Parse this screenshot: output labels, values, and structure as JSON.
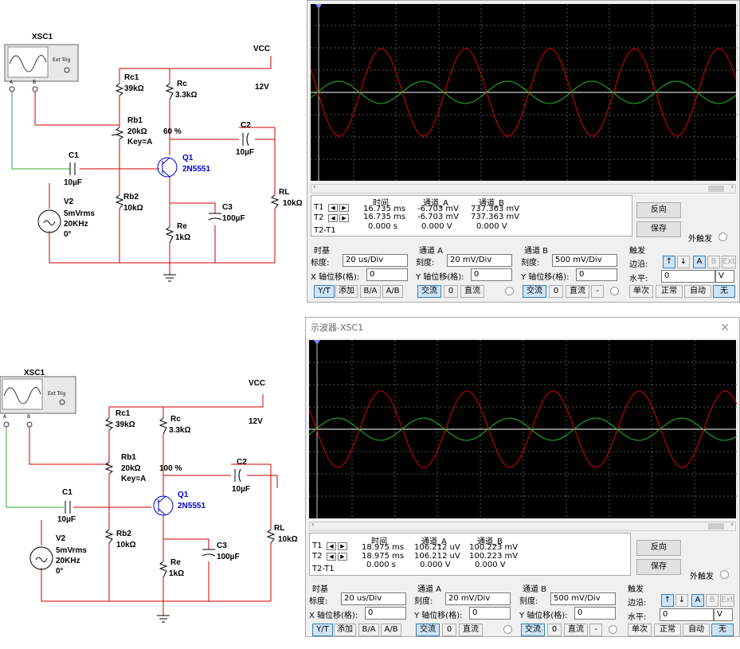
{
  "panels": [
    {
      "circuit": {
        "scope_name": "XSC1",
        "scope_a": "A",
        "scope_b": "B",
        "ext_trig": "Ext Trig",
        "vcc": "VCC",
        "vcc_value": "12V",
        "rc1": "Rc1",
        "rc1_value": "39kΩ",
        "rc": "Rc",
        "rc_value": "3.3kΩ",
        "rb1": "Rb1",
        "rb1_value": "20kΩ",
        "rb1_key": "Key=A",
        "rb1_percent": "60 %",
        "c2": "C2",
        "c2_value": "10µF",
        "q1": "Q1",
        "q1_model": "2N5551",
        "c1": "C1",
        "c1_value": "10µF",
        "rb2": "Rb2",
        "rb2_value": "10kΩ",
        "rl": "RL",
        "rl_value": "10kΩ",
        "v2": "V2",
        "v2_vrms": "5mVrms",
        "v2_freq": "20KHz",
        "v2_phase": "0°",
        "c3": "C3",
        "c3_value": "100µF",
        "re": "Re",
        "re_value": "1kΩ"
      },
      "scope": {
        "title": "",
        "col_time": "时间",
        "col_a": "通道_A",
        "col_b": "通道_B",
        "t1_label": "T1",
        "t2_label": "T2",
        "t2t1_label": "T2-T1",
        "t1_time": "16.735 ms",
        "t1_a": "-6.703 mV",
        "t1_b": "737.363 mV",
        "t2_time": "16.735 ms",
        "t2_a": "-6.703 mV",
        "t2_b": "737.363 mV",
        "d_time": "0.000 s",
        "d_a": "0.000 V",
        "d_b": "0.000 V"
      }
    },
    {
      "circuit": {
        "scope_name": "XSC1",
        "scope_a": "A",
        "scope_b": "B",
        "ext_trig": "Ext Trig",
        "vcc": "VCC",
        "vcc_value": "12V",
        "rc1": "Rc1",
        "rc1_value": "39kΩ",
        "rc": "Rc",
        "rc_value": "3.3kΩ",
        "rb1": "Rb1",
        "rb1_value": "20kΩ",
        "rb1_key": "Key=A",
        "rb1_percent": "100 %",
        "c2": "C2",
        "c2_value": "10µF",
        "q1": "Q1",
        "q1_model": "2N5551",
        "c1": "C1",
        "c1_value": "10µF",
        "rb2": "Rb2",
        "rb2_value": "10kΩ",
        "rl": "RL",
        "rl_value": "10kΩ",
        "v2": "V2",
        "v2_vrms": "5mVrms",
        "v2_freq": "20KHz",
        "v2_phase": "0°",
        "c3": "C3",
        "c3_value": "100µF",
        "re": "Re",
        "re_value": "1kΩ"
      },
      "scope": {
        "title": "示波器-XSC1",
        "col_time": "时间",
        "col_a": "通道_A",
        "col_b": "通道_B",
        "t1_label": "T1",
        "t2_label": "T2",
        "t2t1_label": "T2-T1",
        "t1_time": "18.975 ms",
        "t1_a": "106.212 uV",
        "t1_b": "100.223 mV",
        "t2_time": "18.975 ms",
        "t2_a": "106.212 uV",
        "t2_b": "100.223 mV",
        "d_time": "0.000 s",
        "d_a": "0.000 V",
        "d_b": "0.000 V"
      }
    }
  ],
  "controls": {
    "reverse": "反向",
    "save": "保存",
    "ext_trigger": "外触发",
    "timebase": "时基",
    "scale_label": "标度:",
    "scale_value": "20 us/Div",
    "xpos_label": "X 轴位移(格):",
    "xpos_value": "0",
    "yt": "Y/T",
    "add": "添加",
    "ba": "B/A",
    "ab": "A/B",
    "channel_a": "通道 A",
    "channel_b": "通道 B",
    "ch_scale_label": "刻度:",
    "ch_a_scale": "20 mV/Div",
    "ch_b_scale": "500 mV/Div",
    "ypos_label": "Y 轴位移(格):",
    "ypos_a": "0",
    "ypos_b": "0",
    "ac": "交流",
    "zero": "0",
    "dc": "直流",
    "minus": "-",
    "trigger": "触发",
    "edge_label": "边沿:",
    "level_label": "水平:",
    "level_value": "0",
    "level_unit": "V",
    "trig_a": "A",
    "trig_b": "B",
    "trig_ext": "Ext",
    "single": "单次",
    "normal": "正常",
    "auto": "自动",
    "none": "无"
  },
  "colors": {
    "channel_a": "#dd0000",
    "channel_b": "#22bb22",
    "wire": "#cc0000",
    "wire_green": "#33aa33",
    "transistor": "#0000cc"
  }
}
